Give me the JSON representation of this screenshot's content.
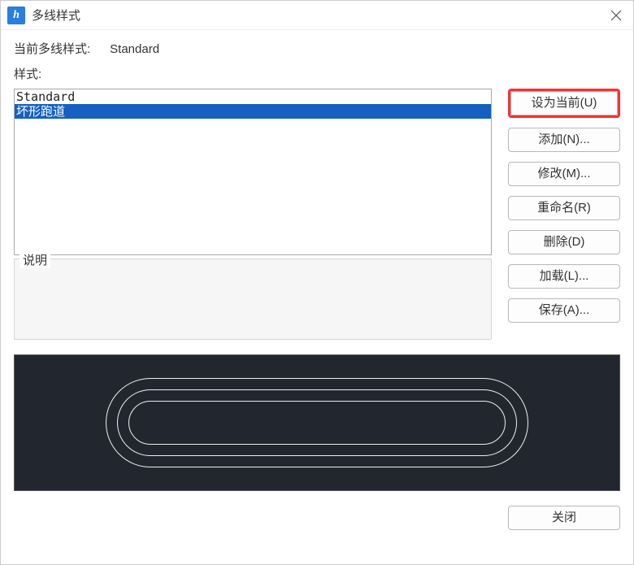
{
  "window": {
    "title": "多线样式"
  },
  "labels": {
    "current_style_label": "当前多线样式:",
    "styles_label": "样式:",
    "description_label": "说明"
  },
  "current_style_value": "Standard",
  "styles_list": {
    "items": [
      "Standard",
      "坏形跑道"
    ],
    "selected_index": 1
  },
  "buttons": {
    "set_current": "设为当前(U)",
    "add": "添加(N)...",
    "modify": "修改(M)...",
    "rename": "重命名(R)",
    "delete": "删除(D)",
    "load": "加载(L)...",
    "save": "保存(A)...",
    "close": "关闭"
  },
  "highlight": {
    "target_button": "set_current",
    "color": "#ff2e2e"
  },
  "preview": {
    "background": "#22272f",
    "stroke": "#eeeeee",
    "rings_count": 3
  }
}
